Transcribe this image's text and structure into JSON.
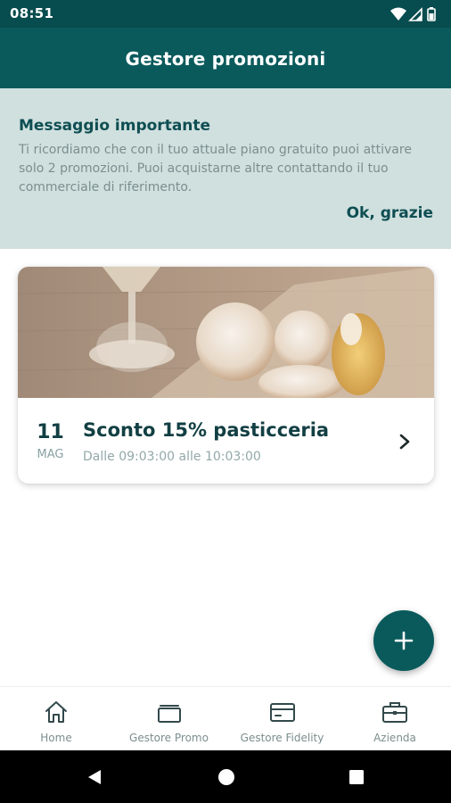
{
  "status_bar": {
    "time": "08:51"
  },
  "app_bar": {
    "title": "Gestore promozioni"
  },
  "banner": {
    "title": "Messaggio importante",
    "text": "Ti ricordiamo che con il tuo attuale piano gratuito puoi attivare solo 2 promozioni. Puoi acquistarne altre contattando il tuo commerciale di riferimento.",
    "action": "Ok, grazie"
  },
  "promo": {
    "day": "11",
    "month": "MAG",
    "title": "Sconto 15% pasticceria",
    "subtitle": "Dalle 09:03:00 alle 10:03:00"
  },
  "fab": {
    "icon": "plus-icon"
  },
  "bottom_nav": {
    "items": [
      {
        "label": "Home",
        "icon": "home-icon"
      },
      {
        "label": "Gestore Promo",
        "icon": "promo-icon"
      },
      {
        "label": "Gestore Fidelity",
        "icon": "card-icon"
      },
      {
        "label": "Azienda",
        "icon": "briefcase-icon"
      }
    ]
  },
  "colors": {
    "status_bar": "#074c4e",
    "app_bar": "#0a5a5c",
    "banner_bg": "#d0e0df",
    "accent_text": "#0e4e52",
    "muted_text": "#7b8e8f"
  }
}
